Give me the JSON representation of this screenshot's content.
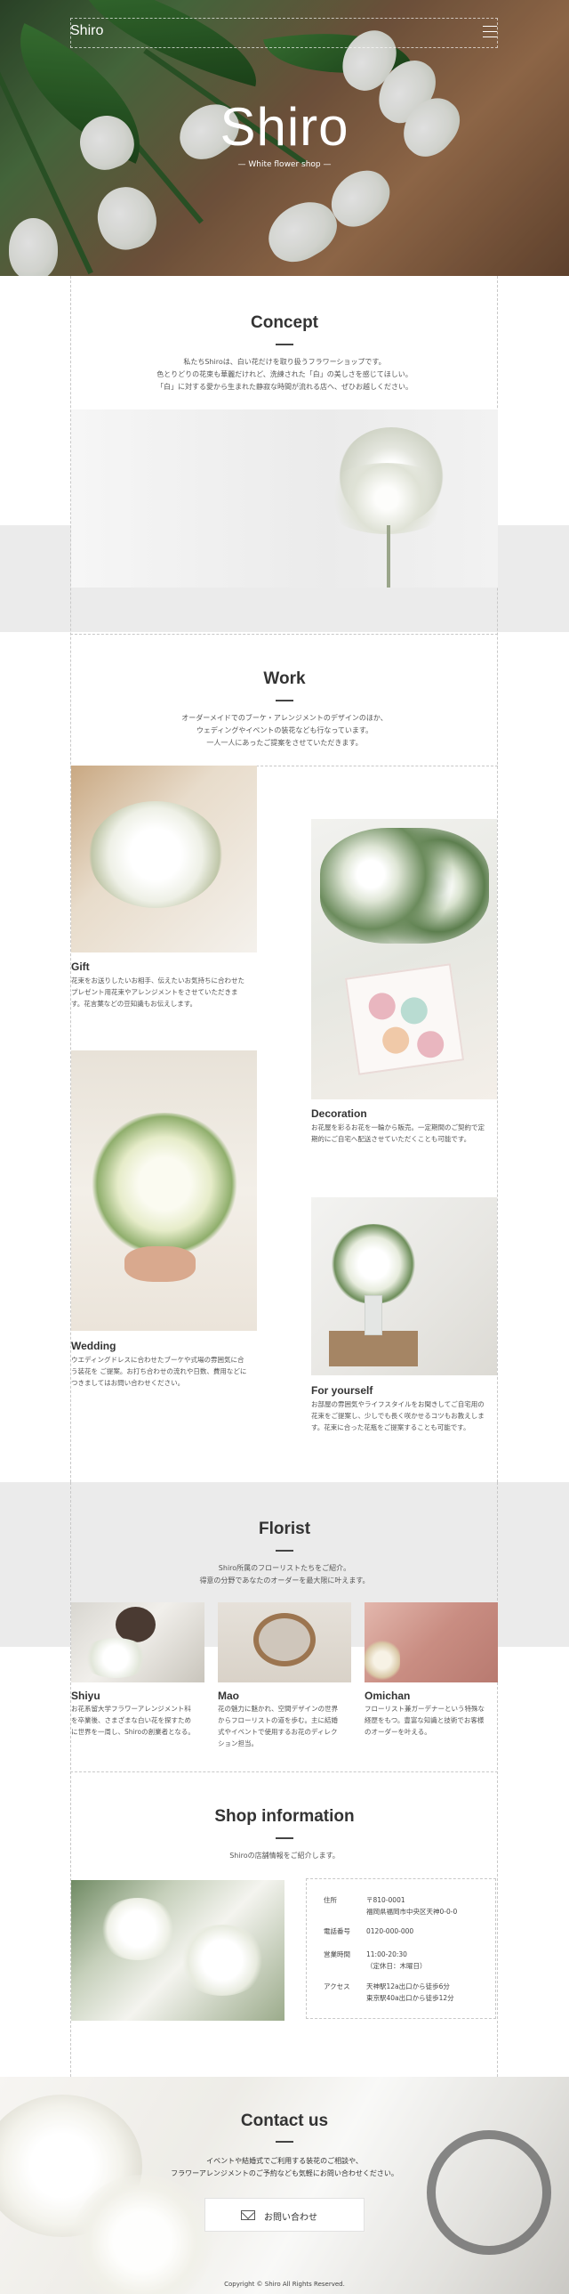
{
  "header": {
    "logo": "Shiro",
    "menu_icon": "hamburger-menu-icon"
  },
  "hero": {
    "title": "Shiro",
    "subtitle": "— White flower shop —"
  },
  "concept": {
    "title": "Concept",
    "lines": [
      "私たちShiroは、白い花だけを取り扱うフラワーショップです。",
      "色とりどりの花束も華麗だけれど、洗練された「白」の美しさを感じてほしい。",
      "「白」に対する愛から生まれた静寂な時間が流れる店へ、ぜひお越しください。"
    ]
  },
  "work": {
    "title": "Work",
    "lines": [
      "オーダーメイドでのブーケ・アレンジメントのデザインのほか、",
      "ウェディングやイベントの装花なども行なっています。",
      "一人一人にあったご提案をさせていただきます。"
    ],
    "items": [
      {
        "label": "Gift",
        "text": [
          "花束をお送りしたいお相手、伝えたいお気持ちに合わせた",
          "プレゼント用花束やアレンジメントをさせていただきま",
          "す。花言葉などの豆知識もお伝えします。"
        ]
      },
      {
        "label": "Decoration",
        "text": [
          "お花屋を彩るお花を一輪から販売。一定期間のご契約で定",
          "期的にご自宅へ配送させていただくことも可能です。"
        ]
      },
      {
        "label": "Wedding",
        "text": [
          "ウエディングドレスに合わせたブーケや式場の雰囲気に合",
          "う装花を ご提案。お打ち合わせの流れや日数、費用などに",
          "つきましてはお問い合わせください。"
        ]
      },
      {
        "label": "For yourself",
        "text": [
          "お部屋の雰囲気やライフスタイルをお聞きしてご自宅用の",
          "花束をご提案し、少しでも長く咲かせるコツもお教えしま",
          "す。花束に合った花瓶をご提案することも可能です。"
        ]
      }
    ]
  },
  "florist": {
    "title": "Florist",
    "lines": [
      "Shiro所属のフローリストたちをご紹介。",
      "得意の分野であなたのオーダーを最大限に叶えます。"
    ],
    "people": [
      {
        "name": "Shiyu",
        "text": [
          "お花系留大学フラワーアレンジメント科",
          "を卒業後、さまざまな白い花を探すため",
          "に世界を一周し、Shiroの創業者となる。"
        ]
      },
      {
        "name": "Mao",
        "text": [
          "花の魅力に魅かれ、空間デザインの世界",
          "からフローリストの道を歩む。主に結婚",
          "式やイベントで使用するお花のディレク",
          "ション担当。"
        ]
      },
      {
        "name": "Omichan",
        "text": [
          "フローリスト兼ガーデナーという特殊な",
          "経歴をもつ。豊富な知識と技術でお客様",
          "のオーダーを叶える。"
        ]
      }
    ]
  },
  "shop": {
    "title": "Shop information",
    "intro": "Shiroの店舗情報をご紹介します。",
    "rows": [
      {
        "label": "住所",
        "value": [
          "〒810-0001",
          "福岡県福岡市中央区天神0-0-0"
        ]
      },
      {
        "label": "電話番号",
        "value": [
          "0120-000-000"
        ]
      },
      {
        "label": "営業時間",
        "value": [
          "11:00-20:30",
          "（定休日：木曜日）"
        ]
      },
      {
        "label": "アクセス",
        "value": [
          "天神駅12a出口から徒歩6分",
          "東京駅40a出口から徒歩12分"
        ]
      }
    ]
  },
  "contact": {
    "title": "Contact us",
    "lines": [
      "イベントや結婚式でご利用する装花のご相談や、",
      "フラワーアレンジメントのご予約なども気軽にお問い合わせください。"
    ],
    "button": "お問い合わせ",
    "button_icon": "mail-icon"
  },
  "footer": {
    "copyright": "Copyright © Shiro All Rights Reserved."
  }
}
